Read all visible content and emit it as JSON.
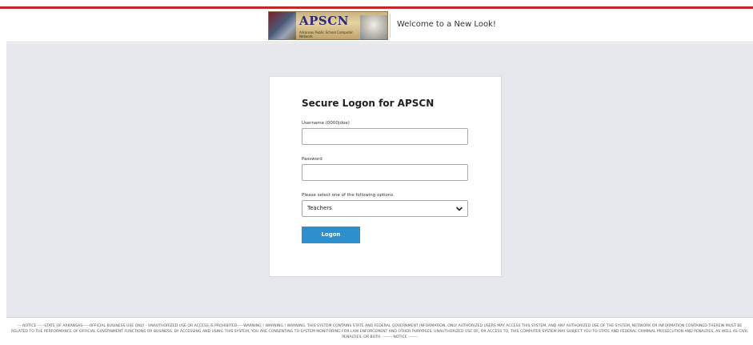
{
  "header": {
    "logo_text": "APSCN",
    "logo_subtext": "Arkansas Public School Computer Network",
    "welcome_text": "Welcome to a New Look!"
  },
  "login": {
    "title": "Secure Logon for APSCN",
    "username_label": "Username (0000jdoe)",
    "username_value": "",
    "password_label": "Password",
    "password_value": "",
    "options_label": "Please select one of the following options.",
    "selected_option": "Teachers",
    "logon_button": "Logon"
  },
  "footer": {
    "notice": "--- NOTICE -----STATE OF ARKANSAS-----OFFICIAL BUSINESS USE ONLY - UNAUTHORIZED USE OR ACCESS IS PROHIBITED-----WARNING ! WARNING ! WARNING. THIS SYSTEM CONTAINS STATE AND FEDERAL GOVERNMENT INFORMATION. ONLY AUTHORIZED USERS MAY ACCESS THIS SYSTEM, AND ANY AUTHORIZED USE OF THE SYSTEM, NETWORK OR INFORMATION CONTAINED THEREIN MUST BE RELATED TO THE PERFORMANCE OF OFFICIAL GOVERNMENT FUNCTIONS OR BUSINESS. BY ACCESSING AND USING THIS SYSTEM, YOU ARE CONSENTING TO SYSTEM MONITORING FOR LAW ENFORCEMENT AND OTHER PURPOSES. UNAUTHORIZED USE OF, OR ACCESS TO, THIS COMPUTER SYSTEM MAY SUBJECT YOU TO STATE AND FEDERAL CRIMINAL PROSECUTION AND PENALTIES, AS WELL AS CIVIL PENALTIES, OR BOTH. ------- NOTICE -------"
  },
  "colors": {
    "accent_red": "#c4262e",
    "button_blue": "#2e8fce",
    "background": "#e5e7ec"
  },
  "icons": {
    "select_arrow": "chevron-down-icon"
  }
}
